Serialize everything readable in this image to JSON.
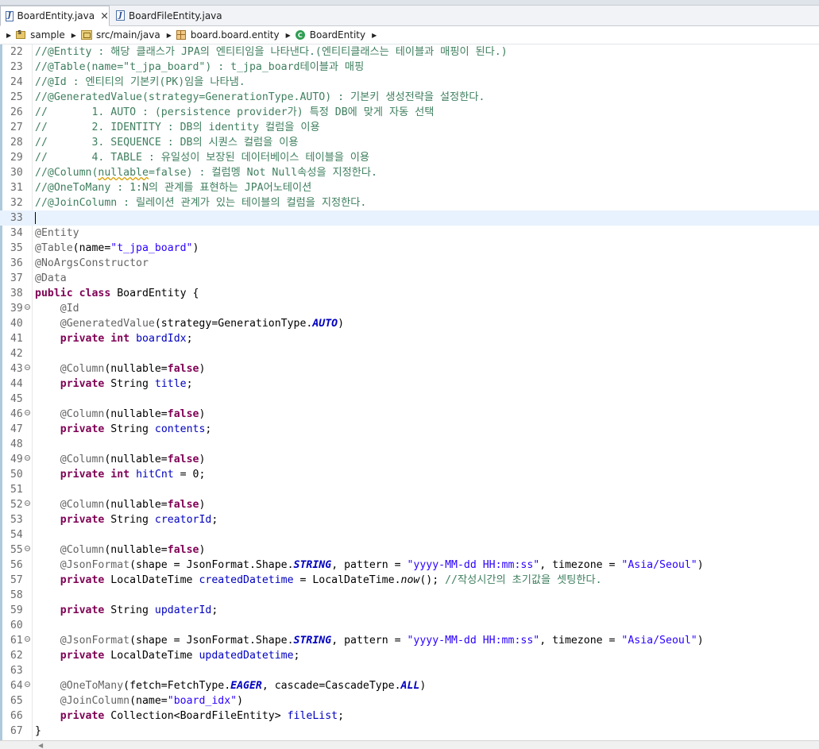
{
  "tabs": [
    {
      "label": "BoardEntity.java",
      "icon": "java-file-icon",
      "active": true,
      "closable": true
    },
    {
      "label": "BoardFileEntity.java",
      "icon": "java-file-icon",
      "active": false,
      "closable": false
    }
  ],
  "tab_close_glyph": "×",
  "breadcrumb": [
    {
      "label": "sample",
      "icon": "project-icon"
    },
    {
      "label": "src/main/java",
      "icon": "source-folder-icon"
    },
    {
      "label": "board.board.entity",
      "icon": "package-icon"
    },
    {
      "label": "BoardEntity",
      "icon": "class-icon"
    }
  ],
  "editor": {
    "current_line": 33,
    "foldable_lines": [
      39,
      43,
      46,
      49,
      52,
      55,
      61,
      64
    ],
    "lines": [
      {
        "n": 22,
        "segs": [
          [
            "cmt",
            "//@Entity : 해당 클래스가 JPA의 엔티티임을 나타낸다.(엔티티클래스는 테이블과 매핑이 된다.)"
          ]
        ]
      },
      {
        "n": 23,
        "segs": [
          [
            "cmt",
            "//@Table(name=\"t_jpa_board\") : t_jpa_board테이블과 매핑"
          ]
        ]
      },
      {
        "n": 24,
        "segs": [
          [
            "cmt",
            "//@Id : 엔티티의 기본키(PK)임을 나타냄."
          ]
        ]
      },
      {
        "n": 25,
        "segs": [
          [
            "cmt",
            "//@GeneratedValue(strategy=GenerationType.AUTO) : 기본키 생성전략을 설정한다."
          ]
        ]
      },
      {
        "n": 26,
        "segs": [
          [
            "cmt",
            "//       1. AUTO : (persistence provider가) 특정 DB에 맞게 자동 선택"
          ]
        ]
      },
      {
        "n": 27,
        "segs": [
          [
            "cmt",
            "//       2. IDENTITY : DB의 identity 컬럼을 이용"
          ]
        ]
      },
      {
        "n": 28,
        "segs": [
          [
            "cmt",
            "//       3. SEQUENCE : DB의 시퀀스 컬럼을 이용"
          ]
        ]
      },
      {
        "n": 29,
        "segs": [
          [
            "cmt",
            "//       4. TABLE : 유일성이 보장된 데이터베이스 테이블을 이용"
          ]
        ]
      },
      {
        "n": 30,
        "segs": [
          [
            "cmt",
            "//@Column("
          ],
          [
            "cmt warn",
            "nullable"
          ],
          [
            "cmt",
            "=false) : 컬럼멩 Not Null속성을 지정한다."
          ]
        ]
      },
      {
        "n": 31,
        "segs": [
          [
            "cmt",
            "//@OneToMany : 1:N의 관계를 표현하는 JPA어노테이션"
          ]
        ]
      },
      {
        "n": 32,
        "segs": [
          [
            "cmt",
            "//@JoinColumn : 릴레이션 관계가 있는 테이블의 컬럼을 지정한다."
          ]
        ]
      },
      {
        "n": 33,
        "segs": [
          [
            "caret",
            ""
          ]
        ]
      },
      {
        "n": 34,
        "segs": [
          [
            "ann",
            "@Entity"
          ]
        ]
      },
      {
        "n": 35,
        "segs": [
          [
            "ann",
            "@Table"
          ],
          [
            "plain",
            "(name="
          ],
          [
            "str",
            "\"t_jpa_board\""
          ],
          [
            "plain",
            ")"
          ]
        ]
      },
      {
        "n": 36,
        "segs": [
          [
            "ann",
            "@NoArgsConstructor"
          ]
        ]
      },
      {
        "n": 37,
        "segs": [
          [
            "ann",
            "@Data"
          ]
        ]
      },
      {
        "n": 38,
        "segs": [
          [
            "kw",
            "public class"
          ],
          [
            "plain",
            " BoardEntity {"
          ]
        ]
      },
      {
        "n": 39,
        "segs": [
          [
            "plain",
            "    "
          ],
          [
            "ann",
            "@Id"
          ]
        ]
      },
      {
        "n": 40,
        "segs": [
          [
            "plain",
            "    "
          ],
          [
            "ann",
            "@GeneratedValue"
          ],
          [
            "plain",
            "(strategy=GenerationType."
          ],
          [
            "sfld",
            "AUTO"
          ],
          [
            "plain",
            ")"
          ]
        ]
      },
      {
        "n": 41,
        "segs": [
          [
            "plain",
            "    "
          ],
          [
            "kw",
            "private int"
          ],
          [
            "plain",
            " "
          ],
          [
            "fld",
            "boardIdx"
          ],
          [
            "plain",
            ";"
          ]
        ]
      },
      {
        "n": 42,
        "segs": []
      },
      {
        "n": 43,
        "segs": [
          [
            "plain",
            "    "
          ],
          [
            "ann",
            "@Column"
          ],
          [
            "plain",
            "(nullable="
          ],
          [
            "kw",
            "false"
          ],
          [
            "plain",
            ")"
          ]
        ]
      },
      {
        "n": 44,
        "segs": [
          [
            "plain",
            "    "
          ],
          [
            "kw",
            "private"
          ],
          [
            "plain",
            " String "
          ],
          [
            "fld",
            "title"
          ],
          [
            "plain",
            ";"
          ]
        ]
      },
      {
        "n": 45,
        "segs": []
      },
      {
        "n": 46,
        "segs": [
          [
            "plain",
            "    "
          ],
          [
            "ann",
            "@Column"
          ],
          [
            "plain",
            "(nullable="
          ],
          [
            "kw",
            "false"
          ],
          [
            "plain",
            ")"
          ]
        ]
      },
      {
        "n": 47,
        "segs": [
          [
            "plain",
            "    "
          ],
          [
            "kw",
            "private"
          ],
          [
            "plain",
            " String "
          ],
          [
            "fld",
            "contents"
          ],
          [
            "plain",
            ";"
          ]
        ]
      },
      {
        "n": 48,
        "segs": []
      },
      {
        "n": 49,
        "segs": [
          [
            "plain",
            "    "
          ],
          [
            "ann",
            "@Column"
          ],
          [
            "plain",
            "(nullable="
          ],
          [
            "kw",
            "false"
          ],
          [
            "plain",
            ")"
          ]
        ]
      },
      {
        "n": 50,
        "segs": [
          [
            "plain",
            "    "
          ],
          [
            "kw",
            "private int"
          ],
          [
            "plain",
            " "
          ],
          [
            "fld",
            "hitCnt"
          ],
          [
            "plain",
            " = 0;"
          ]
        ]
      },
      {
        "n": 51,
        "segs": []
      },
      {
        "n": 52,
        "segs": [
          [
            "plain",
            "    "
          ],
          [
            "ann",
            "@Column"
          ],
          [
            "plain",
            "(nullable="
          ],
          [
            "kw",
            "false"
          ],
          [
            "plain",
            ")"
          ]
        ]
      },
      {
        "n": 53,
        "segs": [
          [
            "plain",
            "    "
          ],
          [
            "kw",
            "private"
          ],
          [
            "plain",
            " String "
          ],
          [
            "fld",
            "creatorId"
          ],
          [
            "plain",
            ";"
          ]
        ]
      },
      {
        "n": 54,
        "segs": []
      },
      {
        "n": 55,
        "segs": [
          [
            "plain",
            "    "
          ],
          [
            "ann",
            "@Column"
          ],
          [
            "plain",
            "(nullable="
          ],
          [
            "kw",
            "false"
          ],
          [
            "plain",
            ")"
          ]
        ]
      },
      {
        "n": 56,
        "segs": [
          [
            "plain",
            "    "
          ],
          [
            "ann",
            "@JsonFormat"
          ],
          [
            "plain",
            "(shape = JsonFormat.Shape."
          ],
          [
            "sfld",
            "STRING"
          ],
          [
            "plain",
            ", pattern = "
          ],
          [
            "str",
            "\"yyyy-MM-dd HH:mm:ss\""
          ],
          [
            "plain",
            ", timezone = "
          ],
          [
            "str",
            "\"Asia/Seoul\""
          ],
          [
            "plain",
            ")"
          ]
        ]
      },
      {
        "n": 57,
        "segs": [
          [
            "plain",
            "    "
          ],
          [
            "kw",
            "private"
          ],
          [
            "plain",
            " LocalDateTime "
          ],
          [
            "fld",
            "createdDatetime"
          ],
          [
            "plain",
            " = LocalDateTime."
          ],
          [
            "ital",
            "now"
          ],
          [
            "plain",
            "(); "
          ],
          [
            "cmt",
            "//작성시간의 초기값을 셋팅한다."
          ]
        ]
      },
      {
        "n": 58,
        "segs": []
      },
      {
        "n": 59,
        "segs": [
          [
            "plain",
            "    "
          ],
          [
            "kw",
            "private"
          ],
          [
            "plain",
            " String "
          ],
          [
            "fld",
            "updaterId"
          ],
          [
            "plain",
            ";"
          ]
        ]
      },
      {
        "n": 60,
        "segs": []
      },
      {
        "n": 61,
        "segs": [
          [
            "plain",
            "    "
          ],
          [
            "ann",
            "@JsonFormat"
          ],
          [
            "plain",
            "(shape = JsonFormat.Shape."
          ],
          [
            "sfld",
            "STRING"
          ],
          [
            "plain",
            ", pattern = "
          ],
          [
            "str",
            "\"yyyy-MM-dd HH:mm:ss\""
          ],
          [
            "plain",
            ", timezone = "
          ],
          [
            "str",
            "\"Asia/Seoul\""
          ],
          [
            "plain",
            ")"
          ]
        ]
      },
      {
        "n": 62,
        "segs": [
          [
            "plain",
            "    "
          ],
          [
            "kw",
            "private"
          ],
          [
            "plain",
            " LocalDateTime "
          ],
          [
            "fld",
            "updatedDatetime"
          ],
          [
            "plain",
            ";"
          ]
        ]
      },
      {
        "n": 63,
        "segs": []
      },
      {
        "n": 64,
        "segs": [
          [
            "plain",
            "    "
          ],
          [
            "ann",
            "@OneToMany"
          ],
          [
            "plain",
            "(fetch=FetchType."
          ],
          [
            "sfld",
            "EAGER"
          ],
          [
            "plain",
            ", cascade=CascadeType."
          ],
          [
            "sfld",
            "ALL"
          ],
          [
            "plain",
            ")"
          ]
        ]
      },
      {
        "n": 65,
        "segs": [
          [
            "plain",
            "    "
          ],
          [
            "ann",
            "@JoinColumn"
          ],
          [
            "plain",
            "(name="
          ],
          [
            "str",
            "\"board_idx\""
          ],
          [
            "plain",
            ")"
          ]
        ]
      },
      {
        "n": 66,
        "segs": [
          [
            "plain",
            "    "
          ],
          [
            "kw",
            "private"
          ],
          [
            "plain",
            " Collection<BoardFileEntity> "
          ],
          [
            "fld",
            "fileList"
          ],
          [
            "plain",
            ";"
          ]
        ]
      },
      {
        "n": 67,
        "segs": [
          [
            "plain",
            "}"
          ]
        ]
      }
    ]
  },
  "colors": {
    "comment": "#3f7f5f",
    "keyword": "#7f0055",
    "annotation": "#646464",
    "string": "#2a00ff",
    "field": "#0000c0",
    "current_line_bg": "#e8f2fe"
  }
}
